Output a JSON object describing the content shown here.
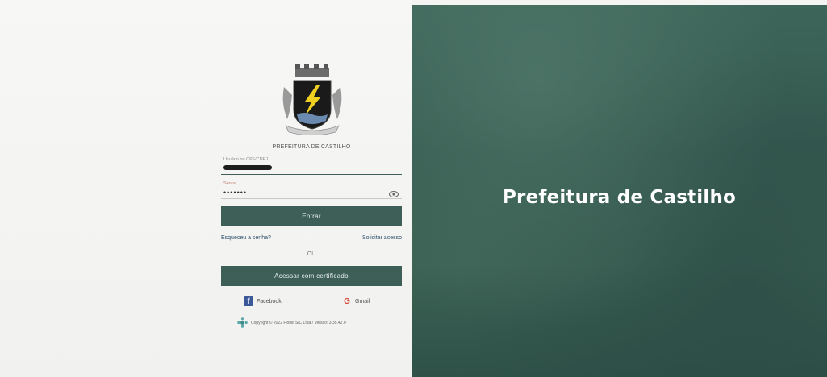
{
  "hero": {
    "title": "Prefeitura de Castilho"
  },
  "brand": {
    "org_name": "PREFEITURA DE CASTILHO",
    "logo_icon": "coat-of-arms-icon"
  },
  "login": {
    "username_label": "Usuário ou CPF/CNPJ",
    "password_label": "Senha",
    "password_value": "•••••••",
    "enter_label": "Entrar",
    "forgot_label": "Esqueceu a senha?",
    "request_label": "Solicitar acesso",
    "or_label": "OU",
    "certificate_label": "Acessar com certificado",
    "facebook_label": "Facebook",
    "gmail_label": "Gmail"
  },
  "footer": {
    "copyright": "Copyright © 2022 Fiorilli S/C Ltda / Versão: 3.35.42.0"
  },
  "colors": {
    "primary": "#3d5f58",
    "hero_bg": "#3d6559",
    "link": "#2f4f6a"
  }
}
